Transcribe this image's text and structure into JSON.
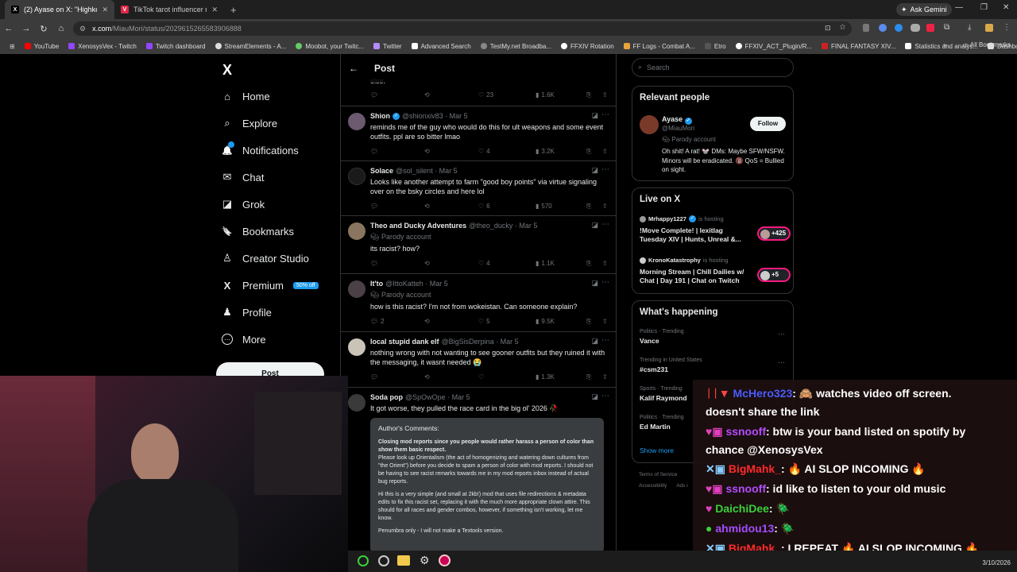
{
  "browser": {
    "tabs": [
      {
        "label": "(2) Ayase on X: \"Highkey, it get",
        "favicon": "X",
        "active": true
      },
      {
        "label": "TikTok tarot influencer must pa",
        "favicon": "V",
        "active": false
      }
    ],
    "ask_gemini": "Ask Gemini",
    "url_host": "x.com",
    "url_path": "/MiauMori/status/2029615265583906888",
    "bookmarks": [
      "YouTube",
      "XenosysVex - Twitch",
      "Twitch dashboard",
      "StreamElements - A...",
      "Moobot, your Twitc...",
      "Twitter",
      "Advanced Search",
      "TestMy.net Broadba...",
      "FFXIV Rotation",
      "FF Logs - Combat A...",
      "Etro",
      "FFXIV_ACT_Plugin/R...",
      "FINAL FANTASY XIV...",
      "Statistics and analys...",
      "Dashboard"
    ],
    "all_bookmarks": "All Bookmarks"
  },
  "nav": {
    "logo": "X",
    "items": [
      {
        "label": "Home",
        "icon": "⌂"
      },
      {
        "label": "Explore",
        "icon": "⌕"
      },
      {
        "label": "Notifications",
        "icon": "🔔"
      },
      {
        "label": "Chat",
        "icon": "✉"
      },
      {
        "label": "Grok",
        "icon": "◪"
      },
      {
        "label": "Bookmarks",
        "icon": "🔖"
      },
      {
        "label": "Creator Studio",
        "icon": "♙"
      },
      {
        "label": "Premium",
        "icon": "X"
      },
      {
        "label": "Profile",
        "icon": "♟"
      },
      {
        "label": "More",
        "icon": "⋯"
      }
    ],
    "premium_badge": "50% off",
    "post_button": "Post"
  },
  "timeline": {
    "header": "Post",
    "prev_text": "else.",
    "prev_actions": {
      "likes": "23",
      "views": "1.6K"
    },
    "tweets": [
      {
        "name": "Shion",
        "handle": "@shionxiv83 · Mar 5",
        "verified": true,
        "parody": "",
        "text": "reminds me of the guy who would do this for ult weapons and some event outfits. ppl are so bitter lmao",
        "replies": "",
        "likes": "4",
        "views": "3.2K"
      },
      {
        "name": "Solace",
        "handle": "@sol_silent · Mar 5",
        "verified": false,
        "parody": "",
        "text": "Looks like another attempt to farm \"good boy points\" via virtue signaling over on the bsky circles and here lol",
        "replies": "",
        "likes": "6",
        "views": "570"
      },
      {
        "name": "Theo and Ducky Adventures",
        "handle": "@theo_ducky · Mar 5",
        "verified": false,
        "parody": "Parody account",
        "text": "its racist? how?",
        "replies": "",
        "likes": "4",
        "views": "1.1K"
      },
      {
        "name": "It'to",
        "handle": "@IttoKatteh · Mar 5",
        "verified": false,
        "parody": "Parody account",
        "text": "how is this racist? I'm not from wokeistan. Can someone explain?",
        "replies": "2",
        "likes": "5",
        "views": "9.5K"
      },
      {
        "name": "local stupid dank elf",
        "handle": "@BigSisDerpina · Mar 5",
        "verified": false,
        "parody": "",
        "text": "nothing wrong with not wanting to see gooner outfits but they ruined it with the messaging, it wasnt needed 😭",
        "replies": "",
        "likes": "",
        "views": "1.3K"
      },
      {
        "name": "Soda pop",
        "handle": "@SpOwOpe · Mar 5",
        "verified": false,
        "parody": "",
        "text": "It got worse, they pulled the race card in the big ol' 2026 🥀",
        "replies": "",
        "likes": "",
        "views": ""
      }
    ],
    "author_comments": {
      "title": "Author's Comments:",
      "bold": "Closing mod reports since you people would rather harass a person of color than show them basic respect.",
      "p1": "Please look up Orientalism (the act of homogenizing and watering down cultures from \"the Orient\") before you decide to spam a person of color with mod reports. I should not be having to see racist remarks towards me in my mod reports inbox instead of actual bug reports.",
      "p2": "Hi this is a very simple (and small at 2kb!) mod that uses file redirections & metadata edits to fix this racist set, replacing it with the much more appropriate clown attire. This should for all races and gender combos, however, if something isn't working, let me know.",
      "p3": "Penumbra only - I will not make a Textools version."
    }
  },
  "sidebar": {
    "search_placeholder": "Search",
    "relevant": {
      "title": "Relevant people",
      "name": "Ayase",
      "handle": "@MiauMori",
      "parody": "Parody account",
      "follow": "Follow",
      "bio": "Oh shit! A rat! 🐭 DMs: Maybe SFW/NSFW. Minors will be eradicated. 🔞 QoS = Bullied on sight."
    },
    "live": {
      "title": "Live on X",
      "items": [
        {
          "host": "Mrhappy1227",
          "status": "is hosting",
          "title": "!Move Complete! | lexitlag Tuesday XIV | Hunts, Unreal &...",
          "count": "+425"
        },
        {
          "host": "KronoKatastrophy",
          "status": "is hosting",
          "title": "Morning Stream | Chill Dailies w/ Chat | Day 191 | Chat on Twitch",
          "count": "+5"
        }
      ]
    },
    "happening": {
      "title": "What's happening",
      "trends": [
        {
          "cat": "Politics · Trending",
          "title": "Vance"
        },
        {
          "cat": "Trending in United States",
          "title": "#csm231"
        },
        {
          "cat": "Sports · Trending",
          "title": "Kalif Raymond"
        },
        {
          "cat": "Politics · Trending",
          "title": "Ed Martin"
        }
      ],
      "show_more": "Show more"
    },
    "footer": [
      "Terms of Service",
      "Accessibility",
      "Ads i"
    ]
  },
  "chat": [
    {
      "user": "McHero323",
      "msg": ": 🙈 watches video off screen.",
      "color": "#4a5cff"
    },
    {
      "user": "",
      "msg": "doesn't share the link",
      "color": "#ffffff"
    },
    {
      "user": "ssnooff",
      "msg": ": btw is your band listed on spotify by",
      "color": "#b44cff"
    },
    {
      "user": "",
      "msg": "chance @XenosysVex",
      "color": "#ffffff"
    },
    {
      "user": "BigMahk_",
      "msg": ": 🔥 AI SLOP INCOMING 🔥",
      "color": "#ff2a2a"
    },
    {
      "user": "ssnooff",
      "msg": ": id like to listen to your old music",
      "color": "#b44cff"
    },
    {
      "user": "DaichiDee",
      "msg": ": 🪲",
      "color": "#3ad13a"
    },
    {
      "user": "ahmidou13",
      "msg": ": 🪲",
      "color": "#a34cff"
    },
    {
      "user": "BigMahk_",
      "msg": ": I REPEAT 🔥 AI SLOP INCOMING 🔥",
      "color": "#ff2a2a"
    }
  ],
  "clock": "3/10/2026"
}
